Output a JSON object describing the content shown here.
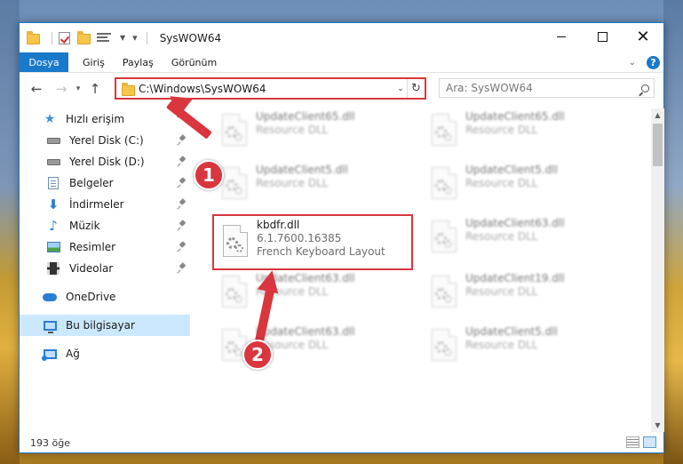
{
  "window": {
    "title": "SysWOW64"
  },
  "ribbon": {
    "tabs": [
      "Dosya",
      "Giriş",
      "Paylaş",
      "Görünüm"
    ],
    "help": "?"
  },
  "nav": {
    "address": "C:\\Windows\\SysWOW64",
    "search_placeholder": "Ara: SysWOW64"
  },
  "sidebar": {
    "quick_access": "Hızlı erişim",
    "items": [
      {
        "label": "Yerel Disk (C:)",
        "icon": "hard-drive-icon",
        "pinned": true
      },
      {
        "label": "Yerel Disk (D:)",
        "icon": "hard-drive-icon",
        "pinned": true
      },
      {
        "label": "Belgeler",
        "icon": "documents-icon",
        "pinned": true
      },
      {
        "label": "İndirmeler",
        "icon": "downloads-icon",
        "pinned": true
      },
      {
        "label": "Müzik",
        "icon": "music-icon",
        "pinned": true
      },
      {
        "label": "Resimler",
        "icon": "pictures-icon",
        "pinned": true
      },
      {
        "label": "Videolar",
        "icon": "videos-icon",
        "pinned": true
      }
    ],
    "onedrive": "OneDrive",
    "this_pc": "Bu bilgisayar",
    "network": "Ağ"
  },
  "files": [
    {
      "name": "UpdateClient65.dll",
      "line2": "Resource DLL",
      "line3": "",
      "blurred": true
    },
    {
      "name": "UpdateClient65.dll",
      "line2": "Resource DLL",
      "line3": "",
      "blurred": true
    },
    {
      "name": "UpdateClient5.dll",
      "line2": "Resource DLL",
      "line3": "",
      "blurred": true
    },
    {
      "name": "UpdateClient5.dll",
      "line2": "Resource DLL",
      "line3": "",
      "blurred": true
    },
    {
      "name": "kbdfr.dll",
      "line2": "6.1.7600.16385",
      "line3": "French Keyboard Layout",
      "blurred": false
    },
    {
      "name": "UpdateClient63.dll",
      "line2": "Resource DLL",
      "line3": "",
      "blurred": true
    },
    {
      "name": "UpdateClient63.dll",
      "line2": "Resource DLL",
      "line3": "",
      "blurred": true
    },
    {
      "name": "UpdateClient19.dll",
      "line2": "Resource DLL",
      "line3": "",
      "blurred": true
    },
    {
      "name": "UpdateClient63.dll",
      "line2": "Resource DLL",
      "line3": "",
      "blurred": true
    },
    {
      "name": "UpdateClient5.dll",
      "line2": "Resource DLL",
      "line3": "",
      "blurred": true
    }
  ],
  "status": {
    "item_count": "193 öğe"
  },
  "annotations": {
    "step1": "1",
    "step2": "2",
    "color": "#d9363e"
  }
}
